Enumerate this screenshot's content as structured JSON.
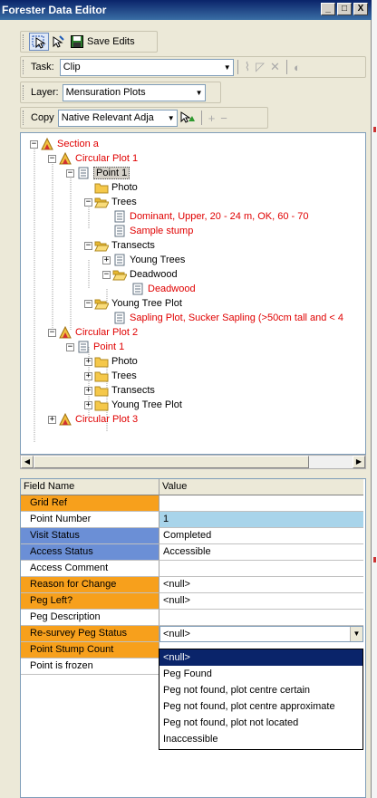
{
  "window": {
    "title": "Forester Data Editor",
    "min": "_",
    "max": "□",
    "close": "X"
  },
  "toolbar1": {
    "save_label": "Save Edits"
  },
  "task": {
    "label": "Task:",
    "value": "Clip"
  },
  "layer": {
    "label": "Layer:",
    "value": "Mensuration Plots"
  },
  "copy": {
    "label": "Copy",
    "value": "Native Relevant Adja",
    "plus": "+",
    "minus": "−"
  },
  "tree": {
    "nodes": [
      {
        "label": "Section a",
        "red": true
      },
      {
        "label": "Circular Plot 1",
        "red": true
      },
      {
        "label": "Point 1",
        "red": false
      },
      {
        "label": "Photo",
        "red": false
      },
      {
        "label": "Trees",
        "red": false
      },
      {
        "label": "Dominant, Upper, 20 - 24 m, OK, 60 - 70",
        "red": true
      },
      {
        "label": "Sample stump",
        "red": true
      },
      {
        "label": "Transects",
        "red": false
      },
      {
        "label": "Young Trees",
        "red": false
      },
      {
        "label": "Deadwood",
        "red": false
      },
      {
        "label": "Deadwood",
        "red": true
      },
      {
        "label": "Young Tree Plot",
        "red": false
      },
      {
        "label": "Sapling Plot, Sucker Sapling (>50cm tall and < 4",
        "red": true
      },
      {
        "label": "Circular Plot 2",
        "red": true
      },
      {
        "label": "Point 1",
        "red": true
      },
      {
        "label": "Photo",
        "red": false
      },
      {
        "label": "Trees",
        "red": false
      },
      {
        "label": "Transects",
        "red": false
      },
      {
        "label": "Young Tree Plot",
        "red": false
      },
      {
        "label": "Circular Plot 3",
        "red": true
      }
    ]
  },
  "grid": {
    "headers": {
      "name": "Field Name",
      "value": "Value"
    },
    "rows": [
      {
        "name": "Grid Ref",
        "value": ""
      },
      {
        "name": "Point Number",
        "value": "1"
      },
      {
        "name": "Visit Status",
        "value": "Completed"
      },
      {
        "name": "Access Status",
        "value": "Accessible"
      },
      {
        "name": "Access Comment",
        "value": ""
      },
      {
        "name": "Reason for Change",
        "value": "<null>"
      },
      {
        "name": "Peg Left?",
        "value": "<null>"
      },
      {
        "name": "Peg Description",
        "value": ""
      },
      {
        "name": "Re-survey Peg Status",
        "value": "<null>"
      },
      {
        "name": "Point Stump Count",
        "value": ""
      },
      {
        "name": "Point is frozen",
        "value": ""
      }
    ],
    "dropdown_options": [
      "<null>",
      "Peg Found",
      "Peg not found, plot centre certain",
      "Peg not found, plot centre approximate",
      "Peg not found, plot not located",
      "Inaccessible"
    ]
  },
  "colors": {
    "orange": "#f7a01c",
    "blue": "#6b8fd6",
    "selected_value": "#a8d4ea",
    "highlight": "#0a246a",
    "red_text": "#e00000"
  }
}
